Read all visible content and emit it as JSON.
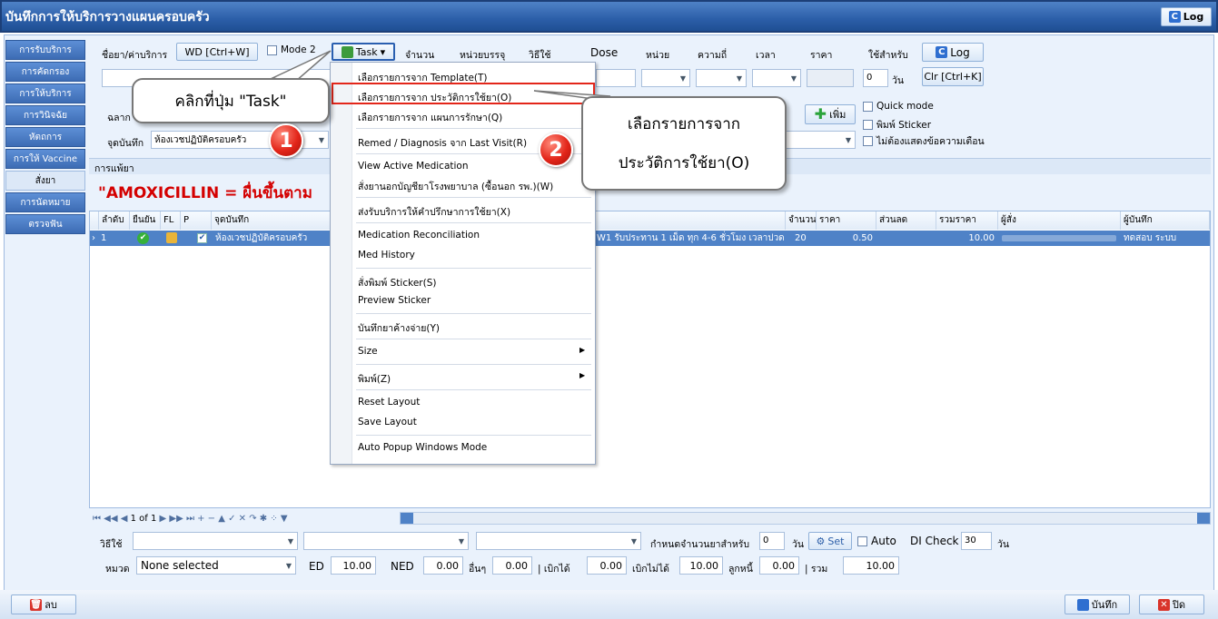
{
  "window": {
    "title": "บันทึกการให้บริการวางแผนครอบครัว",
    "log_label": "Log"
  },
  "nav": {
    "items": [
      "การรับบริการ",
      "การคัดกรอง",
      "การให้บริการ",
      "การวินิจฉัย",
      "หัตถการ",
      "การให้ Vaccine",
      "สั่งยา",
      "การนัดหมาย",
      "ตรวจฟัน"
    ]
  },
  "toolbar": {
    "drug_name_label": "ชื่อยา/ค่าบริการ",
    "wd_button": "WD [Ctrl+W]",
    "mode_label": "Mode 2",
    "task_button": "Task",
    "qty_label": "จำนวน",
    "unit_label": "หน่วยบรรจุ",
    "usage_label": "วิธีใช้",
    "dose_label": "Dose",
    "dose_unit_label": "หน่วย",
    "freq_label": "ความถี่",
    "time_label": "เวลา",
    "price_label": "ราคา",
    "use_for_label": "ใช้สำหรับ",
    "log_button": "Log",
    "days_value": "0",
    "days_unit": "วัน",
    "clr_button": "Clr [Ctrl+K]",
    "label_prefix": "ฉลาก",
    "add_button": "เพิ่ม",
    "quick_mode": "Quick mode",
    "print_sticker": "พิมพ์ Sticker",
    "no_warning": "ไม่ต้องแสดงข้อความเตือน",
    "record_point_label": "จุดบันทึก",
    "record_point_value": "ห้องเวชปฏิบัติครอบครัว"
  },
  "warning": {
    "section_label": "การแพ้ยา",
    "text": "\"AMOXICILLIN = ผื่นขึ้นตาม"
  },
  "grid": {
    "headers_left": [
      "ลำดับ",
      "ยืนยัน",
      "FL",
      "P",
      "จุดบันทึก"
    ],
    "headers_right": [
      "จำนวน",
      "ราคา",
      "ส่วนลด",
      "รวมราคา",
      "ผู้สั่ง",
      "ผู้บันทึก"
    ],
    "row": {
      "seq": "1",
      "location": "ห้องเวชปฏิบัติครอบครัว",
      "usage": "W1 รับประทาน 1 เม็ด ทุก 4-6 ชั่วโมง เวลาปวด",
      "qty": "20",
      "price": "0.50",
      "total": "10.00",
      "recorder": "ทดสอบ ระบบ"
    },
    "pager": "1 of 1"
  },
  "menu": {
    "items": [
      "เลือกรายการจาก Template(T)",
      "เลือกรายการจาก ประวัติการใช้ยา(O)",
      "เลือกรายการจาก แผนการรักษา(Q)",
      "Remed / Diagnosis จาก Last Visit(R)",
      "View Active Medication",
      "สั่งยานอกบัญชียาโรงพยาบาล (ซื้อนอก รพ.)(W)",
      "ส่งรับบริการให้คำปรึกษาการใช้ยา(X)",
      "Medication Reconciliation",
      "Med History",
      "สั่งพิมพ์ Sticker(S)",
      "Preview Sticker",
      "บันทึกยาค้างจ่าย(Y)",
      "Size",
      "พิมพ์(Z)",
      "Reset Layout",
      "Save Layout",
      "Auto Popup Windows Mode"
    ]
  },
  "callouts": {
    "step1_text": "คลิกที่ปุ่ม \"Task\"",
    "step1_num": "1",
    "step2_line1": "เลือกรายการจาก",
    "step2_line2": "ประวัติการใช้ยา(O)",
    "step2_num": "2"
  },
  "footer": {
    "usage_label": "วิธีใช้",
    "days_setting_label": "กำหนดจำนวนยาสำหรับ",
    "days_value": "0",
    "days_unit": "วัน",
    "set_button": "Set",
    "auto_label": "Auto",
    "di_check_label": "DI Check",
    "di_value": "30",
    "di_unit": "วัน",
    "category_label": "หมวด",
    "category_value": "None selected",
    "ed_label": "ED",
    "ed_value": "10.00",
    "ned_label": "NED",
    "ned_value": "0.00",
    "other_label": "อื่นๆ",
    "other_value": "0.00",
    "claimable_label": "| เบิกได้",
    "claimable_value": "0.00",
    "nonclaim_label": "เบิกไม่ได้",
    "nonclaim_value": "10.00",
    "debtor_label": "ลูกหนี้",
    "debtor_value": "0.00",
    "sum_label": "| รวม",
    "sum_value": "10.00"
  },
  "bottom": {
    "delete_button": "ลบ",
    "save_button": "บันทึก",
    "close_button": "ปิด"
  },
  "colors": {
    "title_bar": "#2b5ea8",
    "accent_red": "#e3261a",
    "selected_row": "#4f82c7",
    "warning_text": "#d40000"
  }
}
